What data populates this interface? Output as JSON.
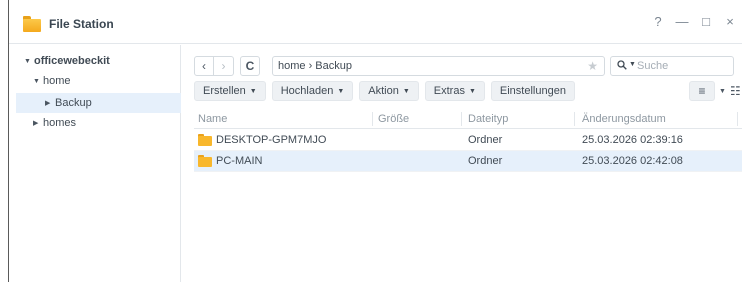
{
  "window": {
    "title": "File Station",
    "controls": {
      "help": "?",
      "minimize": "—",
      "maximize": "□",
      "close": "×"
    }
  },
  "sidebar": {
    "root": "officewebeckit",
    "items": [
      {
        "label": "home",
        "expanded": true
      },
      {
        "label": "Backup",
        "selected": true
      },
      {
        "label": "homes",
        "expanded": false
      }
    ]
  },
  "navigation": {
    "back": "‹",
    "forward": "›",
    "refresh": "C",
    "path": "home › Backup",
    "search_placeholder": "Suche"
  },
  "toolbar": {
    "create": "Erstellen",
    "upload": "Hochladen",
    "action": "Aktion",
    "extras": "Extras",
    "settings": "Einstellungen"
  },
  "table": {
    "headers": [
      "Name",
      "Größe",
      "Dateityp",
      "Änderungsdatum"
    ],
    "rows": [
      {
        "name": "DESKTOP-GPM7MJO",
        "size": "",
        "type": "Ordner",
        "modified": "25.03.2026 02:39:16",
        "selected": false
      },
      {
        "name": "PC-MAIN",
        "size": "",
        "type": "Ordner",
        "modified": "25.03.2026 02:42:08",
        "selected": true
      }
    ]
  },
  "colors": {
    "folder": "#f8b72c",
    "selection": "#e6f0fb",
    "border": "#e3e7eb"
  }
}
